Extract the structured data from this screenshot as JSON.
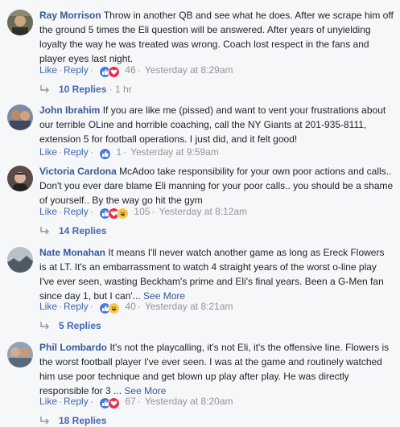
{
  "comments": [
    {
      "author": "Ray Morrison",
      "text": "Throw in another QB and see what he does. After we scrape him off the ground 5 times the Eli question will be answered. After years of unyielding loyalty the way he was treated was wrong. Coach lost respect in the fans and player eyes last night.",
      "see_more": "",
      "like": "Like",
      "reply": "Reply",
      "reactions": [
        "like",
        "love"
      ],
      "reaction_count": "46",
      "time": "Yesterday at 8:29am",
      "replies_label": "10 Replies",
      "replies_meta": "1 hr"
    },
    {
      "author": "John Ibrahim",
      "text": "If you are like me (pissed) and want to vent your frustrations about our terrible OLine and horrible coaching, call the NY Giants at 201-935-8111, extension 5 for football operations. I just did, and it felt good!",
      "see_more": "",
      "like": "Like",
      "reply": "Reply",
      "reactions": [
        "like"
      ],
      "reaction_count": "1",
      "time": "Yesterday at 9:59am",
      "replies_label": "",
      "replies_meta": ""
    },
    {
      "author": "Victoria Cardona",
      "text": "McAdoo take responsibility for your own poor actions and calls.. Don't you ever dare blame Eli manning for your poor calls.. you should be a shame of yourself.. By the way go hit the gym",
      "see_more": "",
      "like": "Like",
      "reply": "Reply",
      "reactions": [
        "like",
        "love",
        "haha"
      ],
      "reaction_count": "105",
      "time": "Yesterday at 8:12am",
      "replies_label": "14 Replies",
      "replies_meta": ""
    },
    {
      "author": "Nate Monahan",
      "text": "It means I'll never watch another game as long as Ereck Flowers is at LT. It's an embarrassment to watch 4 straight years of the worst o-line play I've ever seen, wasting Beckham's prime and Eli's final years. Been a G-Men fan since day 1, but I can'...",
      "see_more": "See More",
      "like": "Like",
      "reply": "Reply",
      "reactions": [
        "like",
        "haha"
      ],
      "reaction_count": "40",
      "time": "Yesterday at 8:21am",
      "replies_label": "5 Replies",
      "replies_meta": ""
    },
    {
      "author": "Phil Lombardo",
      "text": "It's not the playcalling, it's not Eli, it's the offensive line. Flowers is the worst football player I've ever seen. I was at the game and routinely watched him use poor technique and get blown up play after play. He was directly responsible for 3 ...",
      "see_more": "See More",
      "like": "Like",
      "reply": "Reply",
      "reactions": [
        "like",
        "love"
      ],
      "reaction_count": "67",
      "time": "Yesterday at 8:20am",
      "replies_label": "18 Replies",
      "replies_meta": ""
    }
  ],
  "colors": {
    "link": "#365899",
    "action": "#4267b2",
    "meta": "#90949c",
    "background": "#f6f7f9"
  }
}
